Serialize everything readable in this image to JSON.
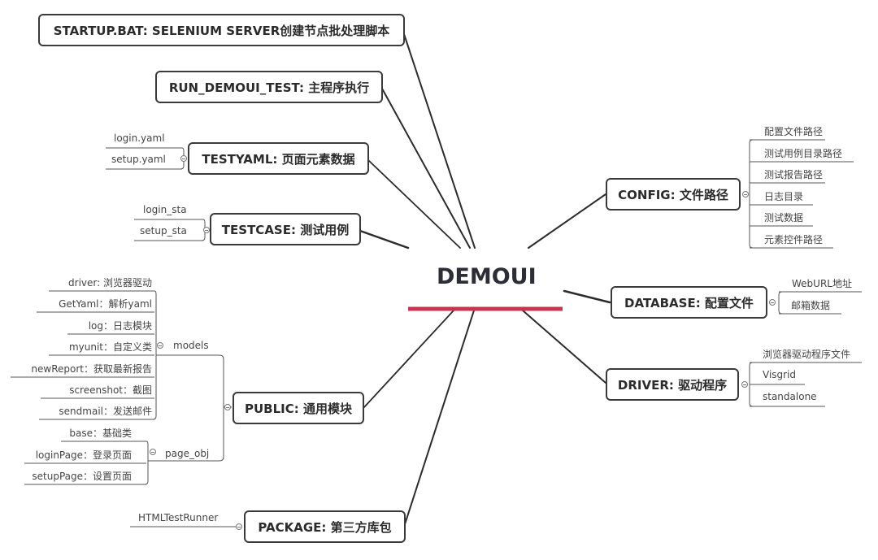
{
  "central": {
    "label": "DEMOUI",
    "underline_color": "#c8344f"
  },
  "topics": {
    "startup": "STARTUP.BAT: SELENIUM SERVER创建节点批处理脚本",
    "run": "RUN_DEMOUI_TEST: 主程序执行",
    "testyaml": "TESTYAML: 页面元素数据",
    "testcase": "TESTCASE: 测试用例",
    "public": "PUBLIC: 通用模块",
    "package": "PACKAGE: 第三方库包",
    "config": "CONFIG: 文件路径",
    "database": "DATABASE: 配置文件",
    "driver": "DRIVER: 驱动程序"
  },
  "testyaml_items": [
    "login.yaml",
    "setup.yaml"
  ],
  "testcase_items": [
    "login_sta",
    "setup_sta"
  ],
  "public_groups": {
    "models": {
      "label": "models",
      "items": [
        "driver: 浏览器驱动",
        "GetYaml：解析yaml",
        "log：日志模块",
        "myunit：自定义类",
        "newReport：获取最新报告",
        "screenshot：截图",
        "sendmail：发送邮件"
      ]
    },
    "page_obj": {
      "label": "page_obj",
      "items": [
        "base：基础类",
        "loginPage：登录页面",
        "setupPage：设置页面"
      ]
    }
  },
  "package_items": [
    "HTMLTestRunner"
  ],
  "config_items": [
    "配置文件路径",
    "测试用例目录路径",
    "测试报告路径",
    "日志目录",
    "测试数据",
    "元素控件路径"
  ],
  "database_items": [
    "WebURL地址",
    "邮箱数据"
  ],
  "driver_items": [
    "浏览器驱动程序文件",
    "Visgrid",
    "standalone"
  ]
}
